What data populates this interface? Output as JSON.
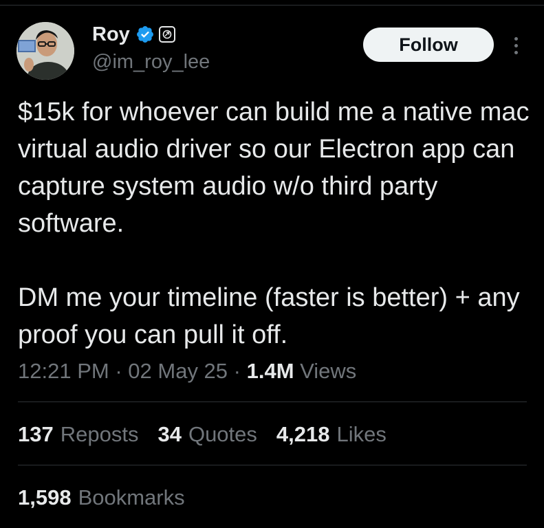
{
  "author": {
    "display_name": "Roy",
    "handle": "@im_roy_lee",
    "verified_color": "#1d9bf0"
  },
  "follow_label": "Follow",
  "tweet": {
    "paragraphs": [
      "$15k for whoever can build me a native mac virtual audio driver so our Electron app can capture system audio w/o third party software.",
      "DM me your timeline (faster is better) + any proof you can pull it off."
    ]
  },
  "meta": {
    "time": "12:21 PM",
    "separator": "·",
    "date": "02 May 25",
    "views_count": "1.4M",
    "views_label": "Views"
  },
  "stats": [
    {
      "count": "137",
      "label": "Reposts"
    },
    {
      "count": "34",
      "label": "Quotes"
    },
    {
      "count": "4,218",
      "label": "Likes"
    }
  ],
  "bookmarks": {
    "count": "1,598",
    "label": "Bookmarks"
  }
}
